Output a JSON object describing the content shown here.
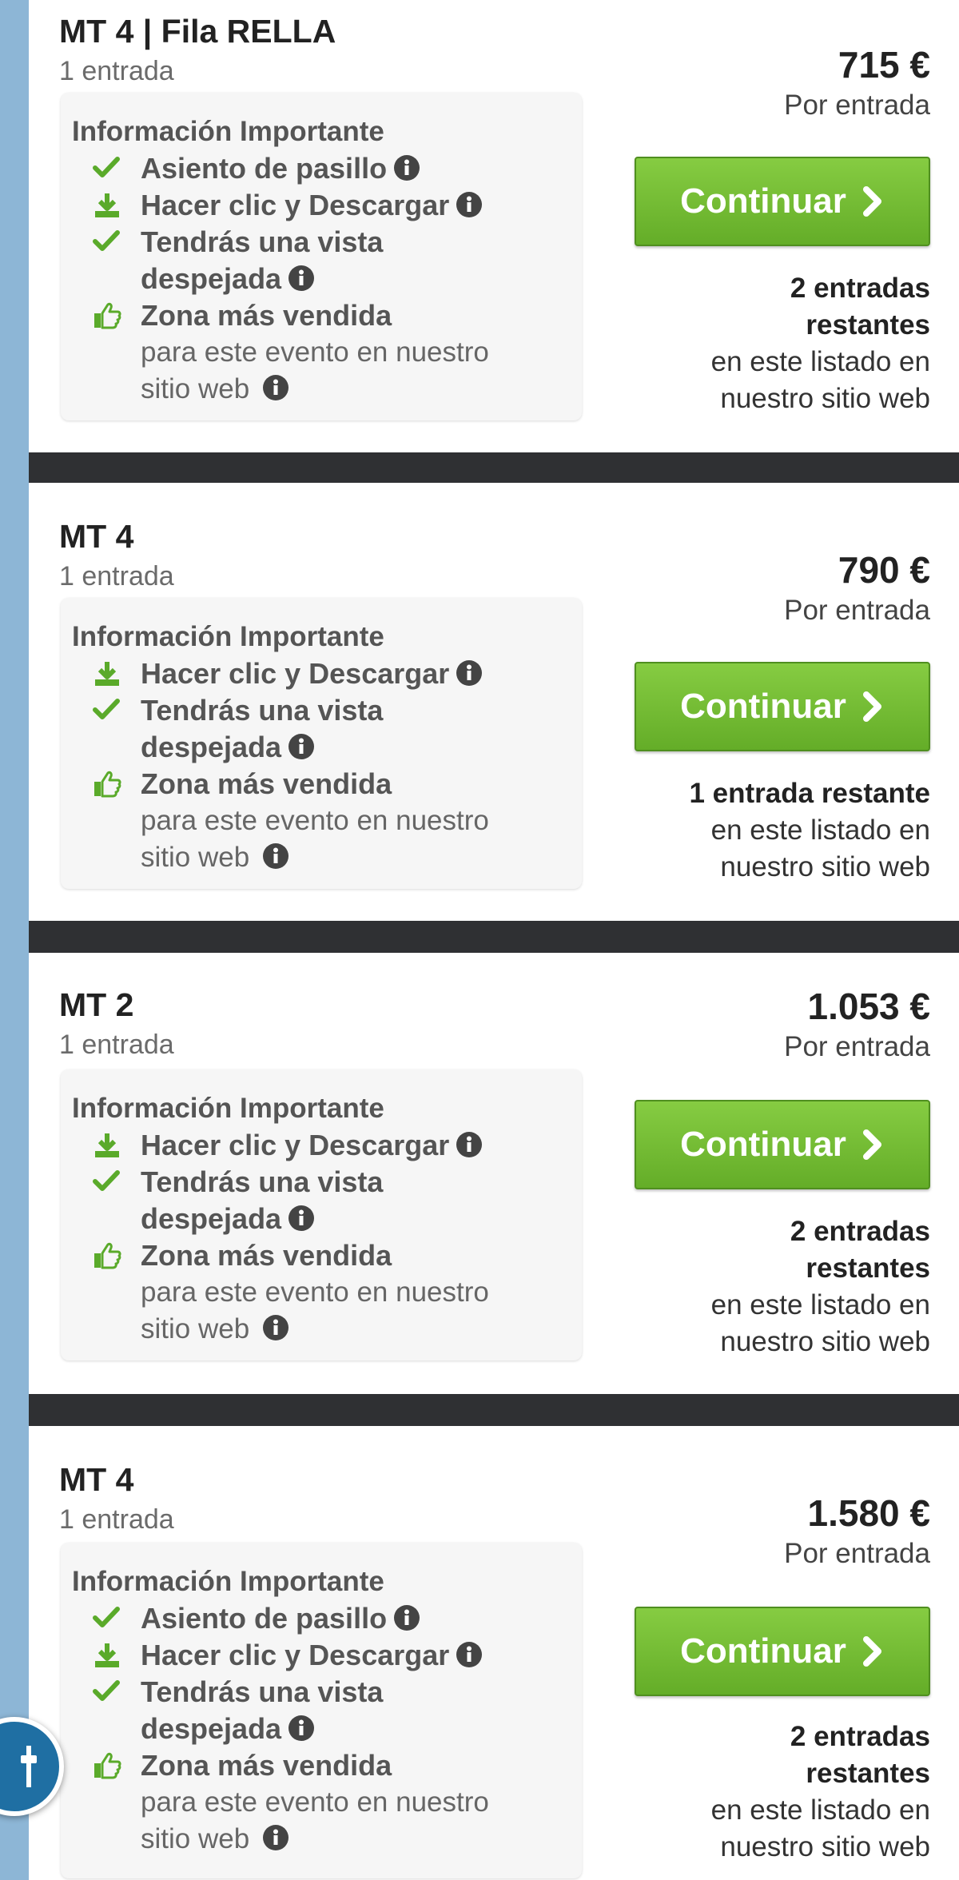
{
  "colors": {
    "accent_green": "#6cb52f",
    "sidebar_blue": "#8db6d6",
    "separator": "#2f3033",
    "fab_blue": "#1f6fa3"
  },
  "listings": [
    {
      "title": "MT 4 | Fila RELLA",
      "quantity": "1 entrada",
      "info_heading": "Información Importante",
      "features": [
        {
          "icon": "check-icon",
          "label": "Asiento de pasillo",
          "sub": ""
        },
        {
          "icon": "download-icon",
          "label": "Hacer clic y Descargar",
          "sub": ""
        },
        {
          "icon": "check-icon",
          "label": "Tendrás una vista despejada",
          "sub": ""
        },
        {
          "icon": "thumbs-up-icon",
          "label": "Zona más vendida",
          "sub": "para este evento en nuestro sitio web"
        }
      ],
      "price": "715 €",
      "per_unit": "Por entrada",
      "button_label": "Continuar",
      "remaining": "2 entradas restantes",
      "remaining_note": "en este listado en nuestro sitio web"
    },
    {
      "title": "MT 4",
      "quantity": "1 entrada",
      "info_heading": "Información Importante",
      "features": [
        {
          "icon": "download-icon",
          "label": "Hacer clic y Descargar",
          "sub": ""
        },
        {
          "icon": "check-icon",
          "label": "Tendrás una vista despejada",
          "sub": ""
        },
        {
          "icon": "thumbs-up-icon",
          "label": "Zona más vendida",
          "sub": "para este evento en nuestro sitio web"
        }
      ],
      "price": "790 €",
      "per_unit": "Por entrada",
      "button_label": "Continuar",
      "remaining": "1 entrada restante",
      "remaining_note": "en este listado en nuestro sitio web"
    },
    {
      "title": "MT 2",
      "quantity": "1 entrada",
      "info_heading": "Información Importante",
      "features": [
        {
          "icon": "download-icon",
          "label": "Hacer clic y Descargar",
          "sub": ""
        },
        {
          "icon": "check-icon",
          "label": "Tendrás una vista despejada",
          "sub": ""
        },
        {
          "icon": "thumbs-up-icon",
          "label": "Zona más vendida",
          "sub": "para este evento en nuestro sitio web"
        }
      ],
      "price": "1.053 €",
      "per_unit": "Por entrada",
      "button_label": "Continuar",
      "remaining": "2 entradas restantes",
      "remaining_note": "en este listado en nuestro sitio web"
    },
    {
      "title": "MT 4",
      "quantity": "1 entrada",
      "info_heading": "Información Importante",
      "features": [
        {
          "icon": "check-icon",
          "label": "Asiento de pasillo",
          "sub": ""
        },
        {
          "icon": "download-icon",
          "label": "Hacer clic y Descargar",
          "sub": ""
        },
        {
          "icon": "check-icon",
          "label": "Tendrás una vista despejada",
          "sub": ""
        },
        {
          "icon": "thumbs-up-icon",
          "label": "Zona más vendida",
          "sub": "para este evento en nuestro sitio web"
        }
      ],
      "price": "1.580 €",
      "per_unit": "Por entrada",
      "button_label": "Continuar",
      "remaining": "2 entradas restantes",
      "remaining_note": "en este listado en nuestro sitio web"
    }
  ],
  "fab": {
    "icon": "filter-icon"
  }
}
